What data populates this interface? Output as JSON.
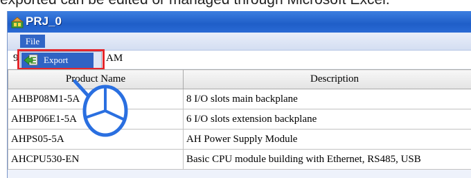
{
  "caption": "exported can be edited or managed through Microsoft Excel.",
  "window": {
    "title": "PRJ_0"
  },
  "menubar": {
    "file_label": "File"
  },
  "context_menu": {
    "export_label": "Export"
  },
  "filterbar": {
    "prefix": "9",
    "text": "AM"
  },
  "table": {
    "headers": [
      "Product Name",
      "Description"
    ],
    "rows": [
      [
        "AHBP08M1-5A",
        "8 I/O slots main backplane"
      ],
      [
        "AHBP06E1-5A",
        "6 I/O slots extension backplane"
      ],
      [
        "AHPS05-5A",
        "AH Power Supply Module"
      ],
      [
        "AHCPU530-EN",
        "Basic CPU module building with Ethernet, RS485, USB"
      ]
    ]
  },
  "colors": {
    "titlebar": "#2a6ad4",
    "highlight": "#e4262c",
    "selection": "#2f63c4",
    "pointer": "#2a6fe0"
  },
  "icons": {
    "app": "app-icon",
    "export": "export-icon",
    "pointer": "mouse-click-icon"
  }
}
